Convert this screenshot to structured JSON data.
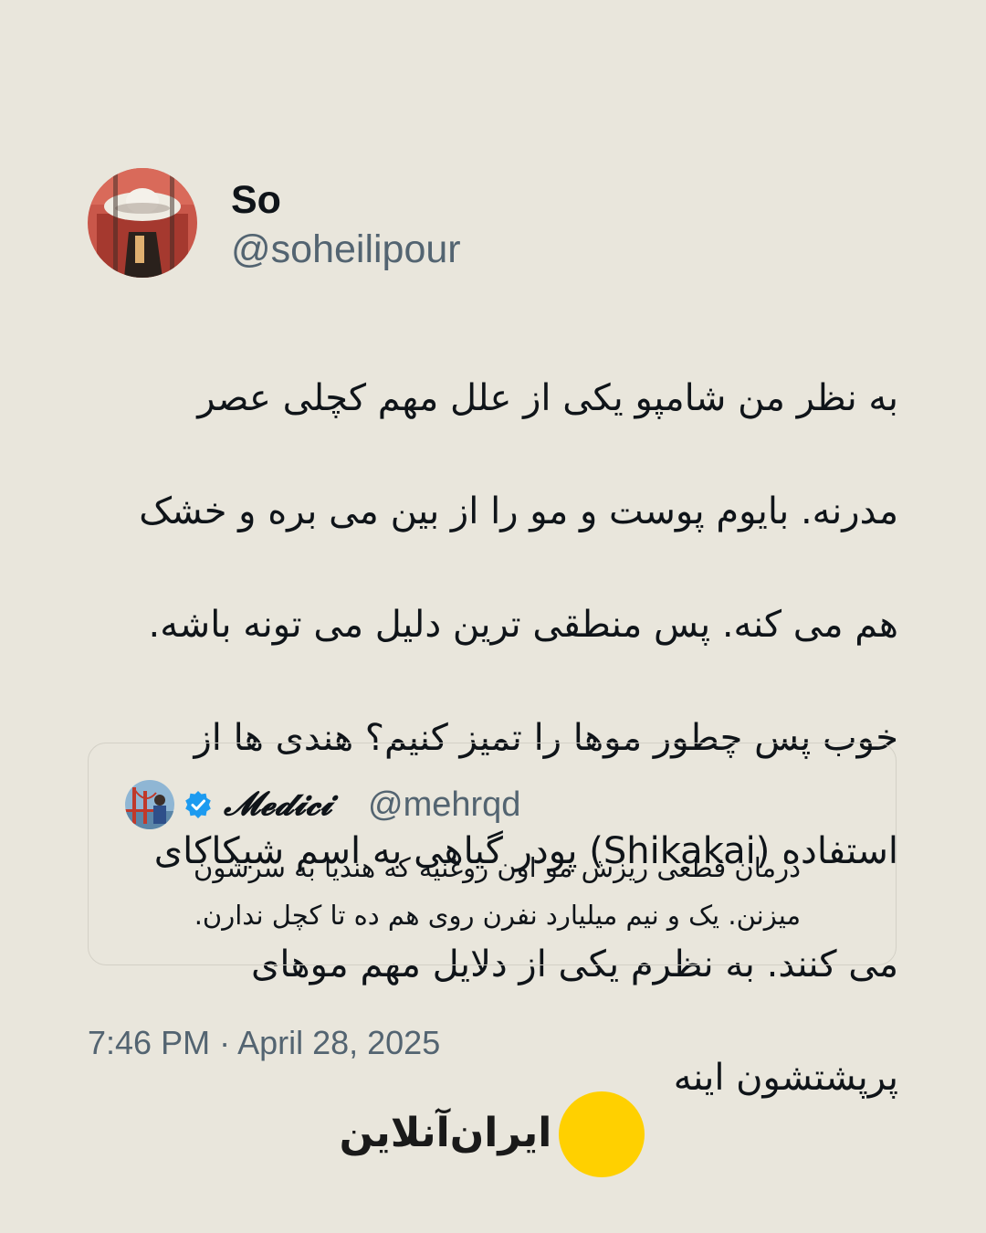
{
  "tweet": {
    "author": {
      "display_name": "So",
      "handle": "@soheilipour",
      "avatar_icon": "sombrero-avatar"
    },
    "text_lines": [
      "به نظر من شامپو یکی از علل مهم کچلی عصر",
      "مدرنه. بایوم پوست و مو را از بین می بره و خشک",
      "هم می کنه. پس منطقی ترین دلیل می تونه باشه.",
      "خوب پس چطور موها را تمیز کنیم؟ هندی ها از",
      "استفاده (Shikakai) پودر گیاهی به اسم شیکاکای",
      "می کنند. به نظرم یکی از دلایل مهم موهای",
      "پرپشتشون اینه"
    ],
    "quoted_tweet": {
      "display_name": "𝓜𝓮𝓭𝓲𝓬𝓲",
      "handle": "@mehrqd",
      "verified_icon": "verified-badge-icon",
      "avatar_icon": "golden-gate-avatar",
      "text_lines": [
        "درمان قطعی ریزش مو اون روغنیه که هندیا به سرشون",
        "میزنن. یک و نیم میلیارد نفرن روی هم ده تا کچل ندارن."
      ]
    },
    "timestamp": "7:46 PM · April 28, 2025"
  },
  "brand": {
    "name": "ایران‌آنلاین",
    "logo_icon": "yellow-circle-logo",
    "accent_color": "#ffd000"
  },
  "colors": {
    "background": "#e9e6dc",
    "text_primary": "#0f1419",
    "text_secondary": "#536471",
    "verified_blue": "#1d9bf0"
  }
}
